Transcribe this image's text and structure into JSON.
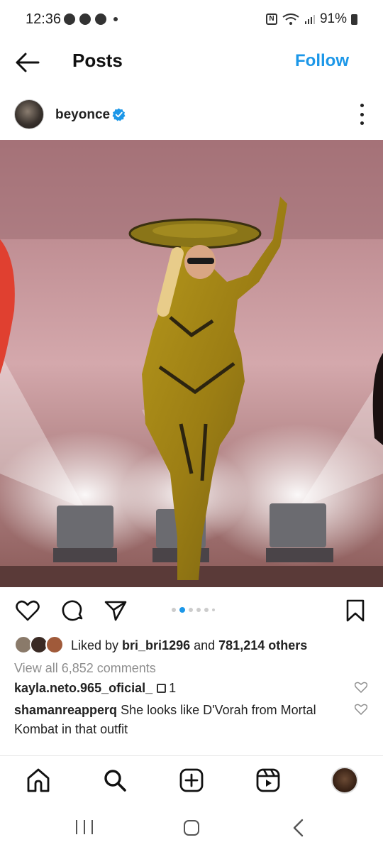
{
  "status_bar": {
    "time": "12:36",
    "notification_icons": [
      "messenger-icon",
      "discord-icon",
      "chrome-icon"
    ],
    "battery": "91%",
    "icons_right": [
      "nfc-icon",
      "wifi-icon",
      "signal-icon",
      "battery-icon"
    ]
  },
  "header": {
    "title": "Posts",
    "follow_label": "Follow"
  },
  "post": {
    "username": "beyonce",
    "verified": true,
    "carousel_count": 6,
    "carousel_active_index": 1,
    "likes": {
      "prefix": "Liked by ",
      "liker": "bri_bri1296",
      "middle": " and ",
      "others": "781,214 others"
    },
    "view_comments": "View all 6,852 comments",
    "comments": [
      {
        "user": "kayla.neto.965_oficial_",
        "text": "",
        "replies": "1"
      },
      {
        "user": "shamanreapperq",
        "text": " She looks like D'Vorah from Mortal Kombat in that outfit"
      }
    ]
  },
  "bottom_nav": [
    "home-icon",
    "search-icon",
    "new-post-icon",
    "reels-icon",
    "profile-avatar"
  ],
  "colors": {
    "accent": "#1c97e8",
    "text": "#222222",
    "muted": "#8e8e8e",
    "verified": "#1c97e8"
  }
}
